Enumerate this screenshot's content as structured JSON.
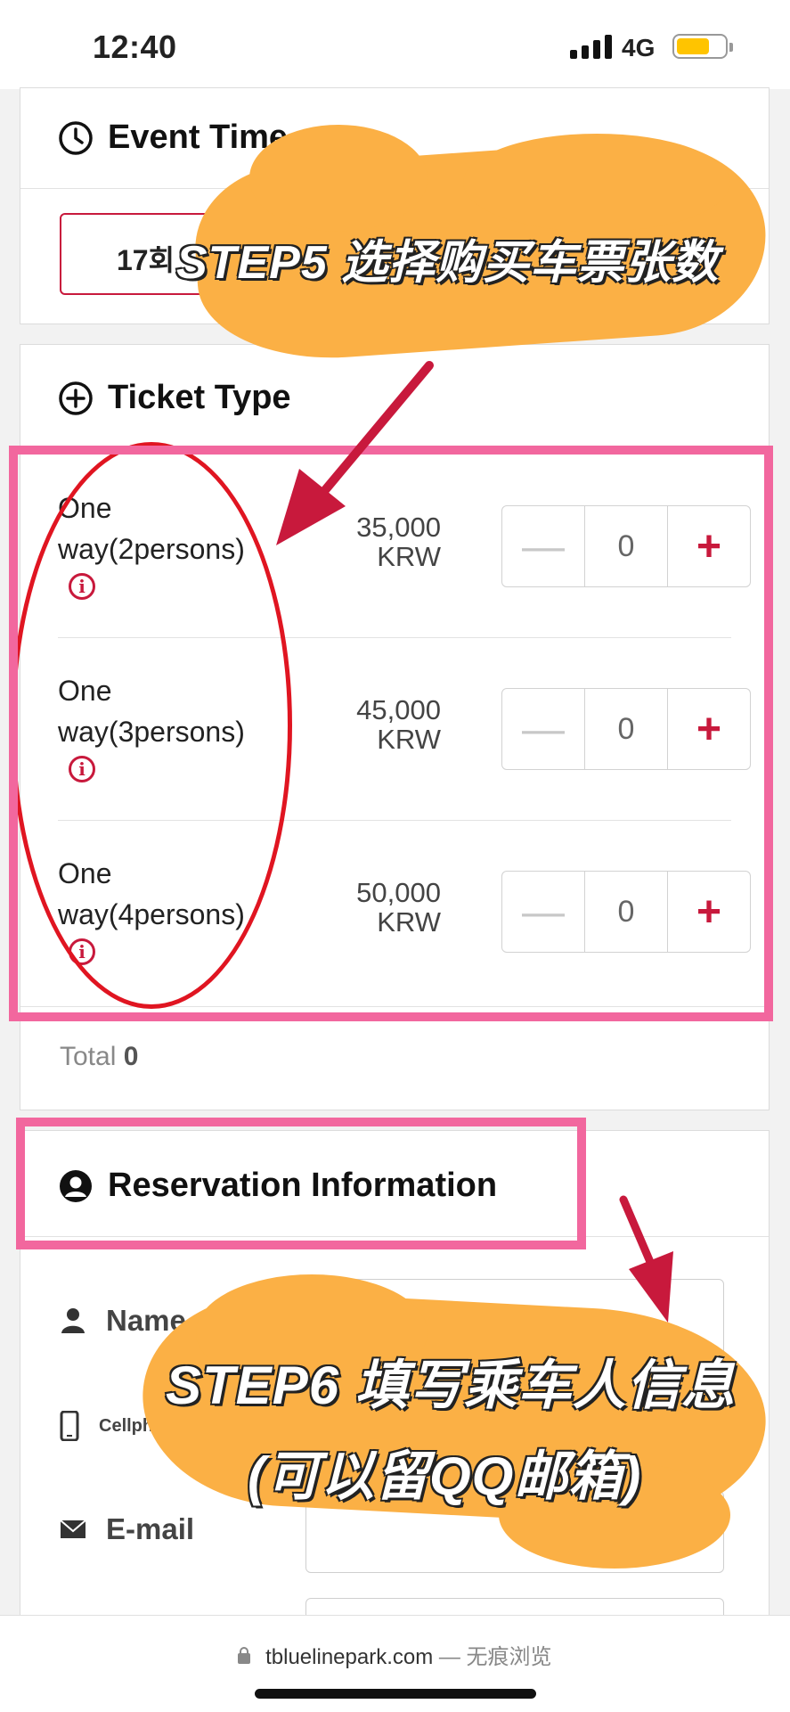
{
  "status_bar": {
    "time": "12:40",
    "network": "4G"
  },
  "event_time": {
    "title": "Event Time",
    "selected": "17회"
  },
  "ticket_type": {
    "title": "Ticket Type",
    "rows": [
      {
        "name": "One way(2persons)",
        "price": "35,000",
        "unit": "KRW",
        "qty": "0"
      },
      {
        "name": "One way(3persons)",
        "price": "45,000",
        "unit": "KRW",
        "qty": "0"
      },
      {
        "name": "One way(4persons)",
        "price": "50,000",
        "unit": "KRW",
        "qty": "0"
      }
    ],
    "minus_symbol": "—",
    "plus_symbol": "+",
    "info_symbol": "i",
    "total_label": "Total",
    "total_value": "0"
  },
  "reservation": {
    "title": "Reservation Information",
    "name_label": "Name",
    "cellphone_label": "Cellph",
    "email_label": "E-mail"
  },
  "annotations": {
    "step5": "STEP5 选择购买车票张数",
    "step6_line1": "STEP6 填写乘车人信息",
    "step6_line2": "(可以留QQ邮箱)"
  },
  "browser": {
    "domain": "tbluelinepark.com",
    "mode": "— 无痕浏览"
  },
  "colors": {
    "accent": "#c8193c",
    "annotation_pink": "#f2679e",
    "annotation_red": "#e01521",
    "annotation_orange": "#fbb045"
  }
}
